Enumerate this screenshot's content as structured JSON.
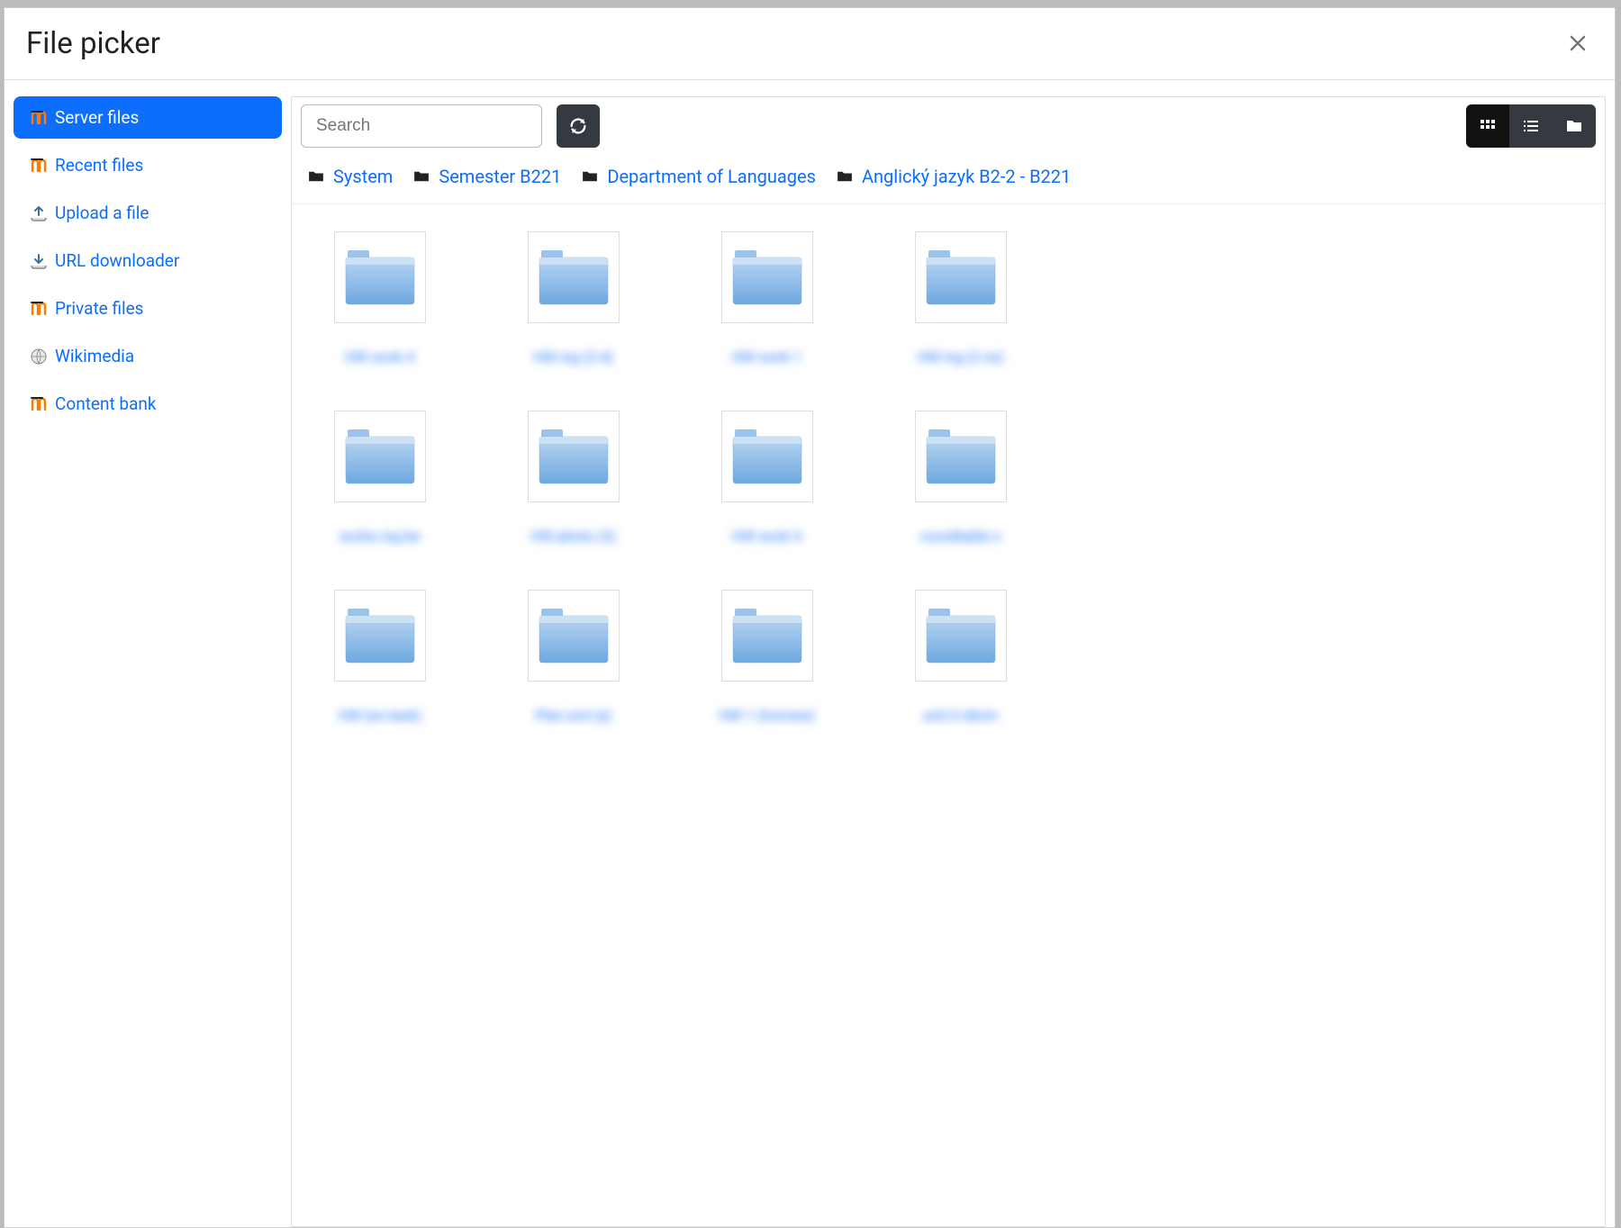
{
  "modal": {
    "title": "File picker"
  },
  "sidebar": {
    "items": [
      {
        "label": "Server files",
        "icon": "moodle",
        "active": true
      },
      {
        "label": "Recent files",
        "icon": "moodle",
        "active": false
      },
      {
        "label": "Upload a file",
        "icon": "upload",
        "active": false
      },
      {
        "label": "URL downloader",
        "icon": "download",
        "active": false
      },
      {
        "label": "Private files",
        "icon": "moodle",
        "active": false
      },
      {
        "label": "Wikimedia",
        "icon": "globe",
        "active": false
      },
      {
        "label": "Content bank",
        "icon": "moodle",
        "active": false
      }
    ]
  },
  "search": {
    "placeholder": "Search"
  },
  "breadcrumb": [
    {
      "label": "System"
    },
    {
      "label": "Semester B221"
    },
    {
      "label": "Department of Languages"
    },
    {
      "label": "Anglický jazyk B2-2 - B221"
    }
  ],
  "files": [
    {
      "label": "HW work 4"
    },
    {
      "label": "HW ing (2-4)"
    },
    {
      "label": "HW work 1"
    },
    {
      "label": "HW ing (2 ex)"
    },
    {
      "label": "works ing be"
    },
    {
      "label": "HW photo (3)"
    },
    {
      "label": "HW work 4"
    },
    {
      "label": "roundtable s"
    },
    {
      "label": "HW (ex-task)"
    },
    {
      "label": "Plan ex4 (a)"
    },
    {
      "label": "HW 1 (homew)"
    },
    {
      "label": "unit 6 idiom"
    }
  ]
}
